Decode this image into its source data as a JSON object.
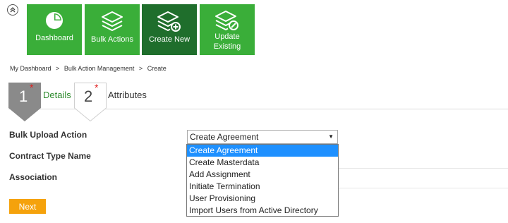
{
  "toolbar": {
    "tiles": [
      {
        "label": "Dashboard",
        "icon": "pie-chart-icon"
      },
      {
        "label": "Bulk Actions",
        "icon": "layers-icon"
      },
      {
        "label": "Create New",
        "icon": "layers-plus-icon"
      },
      {
        "label": "Update Existing",
        "label_line1": "Update",
        "label_line2": "Existing",
        "icon": "layers-edit-icon"
      }
    ]
  },
  "breadcrumb": {
    "items": [
      "My Dashboard",
      "Bulk Action Management",
      "Create"
    ],
    "separator": ">"
  },
  "steps": [
    {
      "number": "1",
      "label": "Details",
      "required_mark": "*"
    },
    {
      "number": "2",
      "label": "Attributes",
      "required_mark": "*"
    }
  ],
  "form": {
    "fields": [
      {
        "label": "Bulk Upload Action"
      },
      {
        "label": "Contract Type Name"
      },
      {
        "label": "Association"
      }
    ],
    "bulk_upload_select": {
      "value": "Create Agreement",
      "options": [
        "Create Agreement",
        "Create Masterdata",
        "Add Assignment",
        "Initiate Termination",
        "User Provisioning",
        "Import Users from Active Directory"
      ]
    },
    "next_label": "Next"
  },
  "colors": {
    "tile_green": "#3aae39",
    "tile_active": "#1f6e2c",
    "step_active": "#8a8a8a",
    "step_label_active": "#2e8b2e",
    "required": "#e02020",
    "selected_option": "#1e90ff",
    "next_button": "#f5a20c"
  }
}
